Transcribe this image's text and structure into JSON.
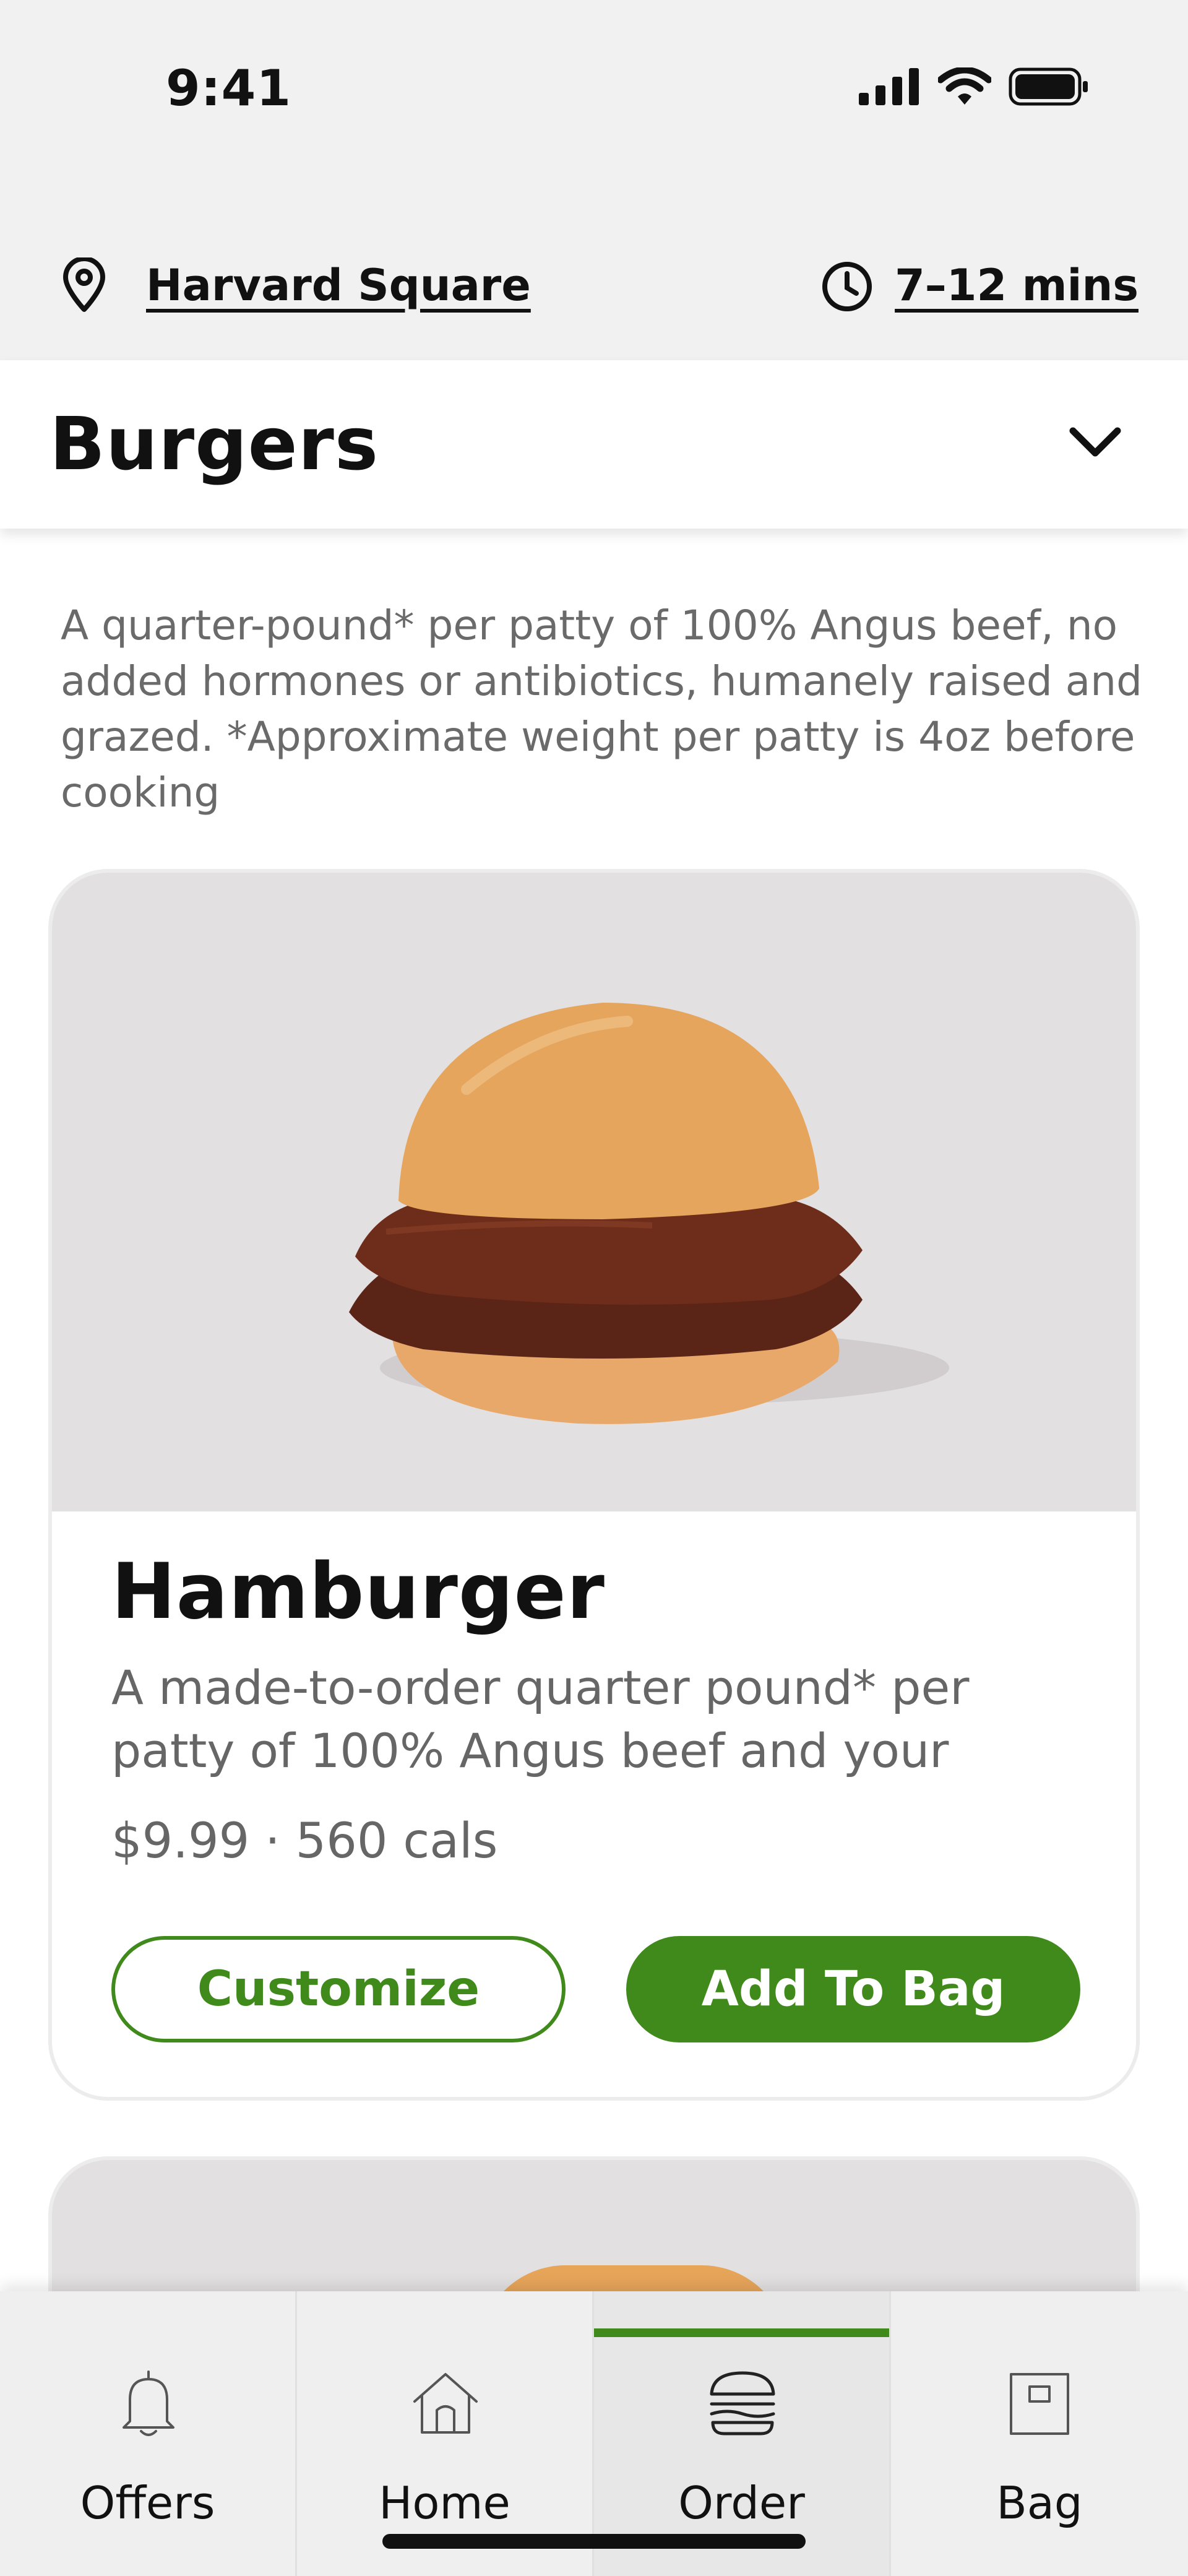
{
  "status_bar": {
    "time": "9:41",
    "icons": [
      "cellular-signal-icon",
      "wifi-icon",
      "battery-icon"
    ]
  },
  "location": {
    "store_name": "Harvard Square",
    "wait_time": "7–12 mins",
    "icons": [
      "location-pin-icon",
      "clock-icon"
    ]
  },
  "category": {
    "title": "Burgers",
    "description": "A quarter-pound* per patty of 100% Angus beef, no added hormones or antibiotics, humanely raised and grazed. *Approximate weight per patty is 4oz before cooking",
    "icon": "chevron-down-icon"
  },
  "product": {
    "name": "Hamburger",
    "description": "A made-to-order quarter pound* per patty of 100% Angus beef and your choice of t...",
    "price_cals": "$9.99 · 560 cals",
    "customize_label": "Customize",
    "add_label": "Add To Bag"
  },
  "tabs": [
    {
      "label": "Offers",
      "icon": "bell-icon",
      "active": false
    },
    {
      "label": "Home",
      "icon": "home-icon",
      "active": false
    },
    {
      "label": "Order",
      "icon": "burger-icon",
      "active": true
    },
    {
      "label": "Bag",
      "icon": "bag-icon",
      "active": false
    }
  ],
  "colors": {
    "accent_green": "#3f8a1b",
    "header_bg": "#f1f1f1",
    "image_bg": "#e3e0e1",
    "muted_text": "#666666"
  }
}
